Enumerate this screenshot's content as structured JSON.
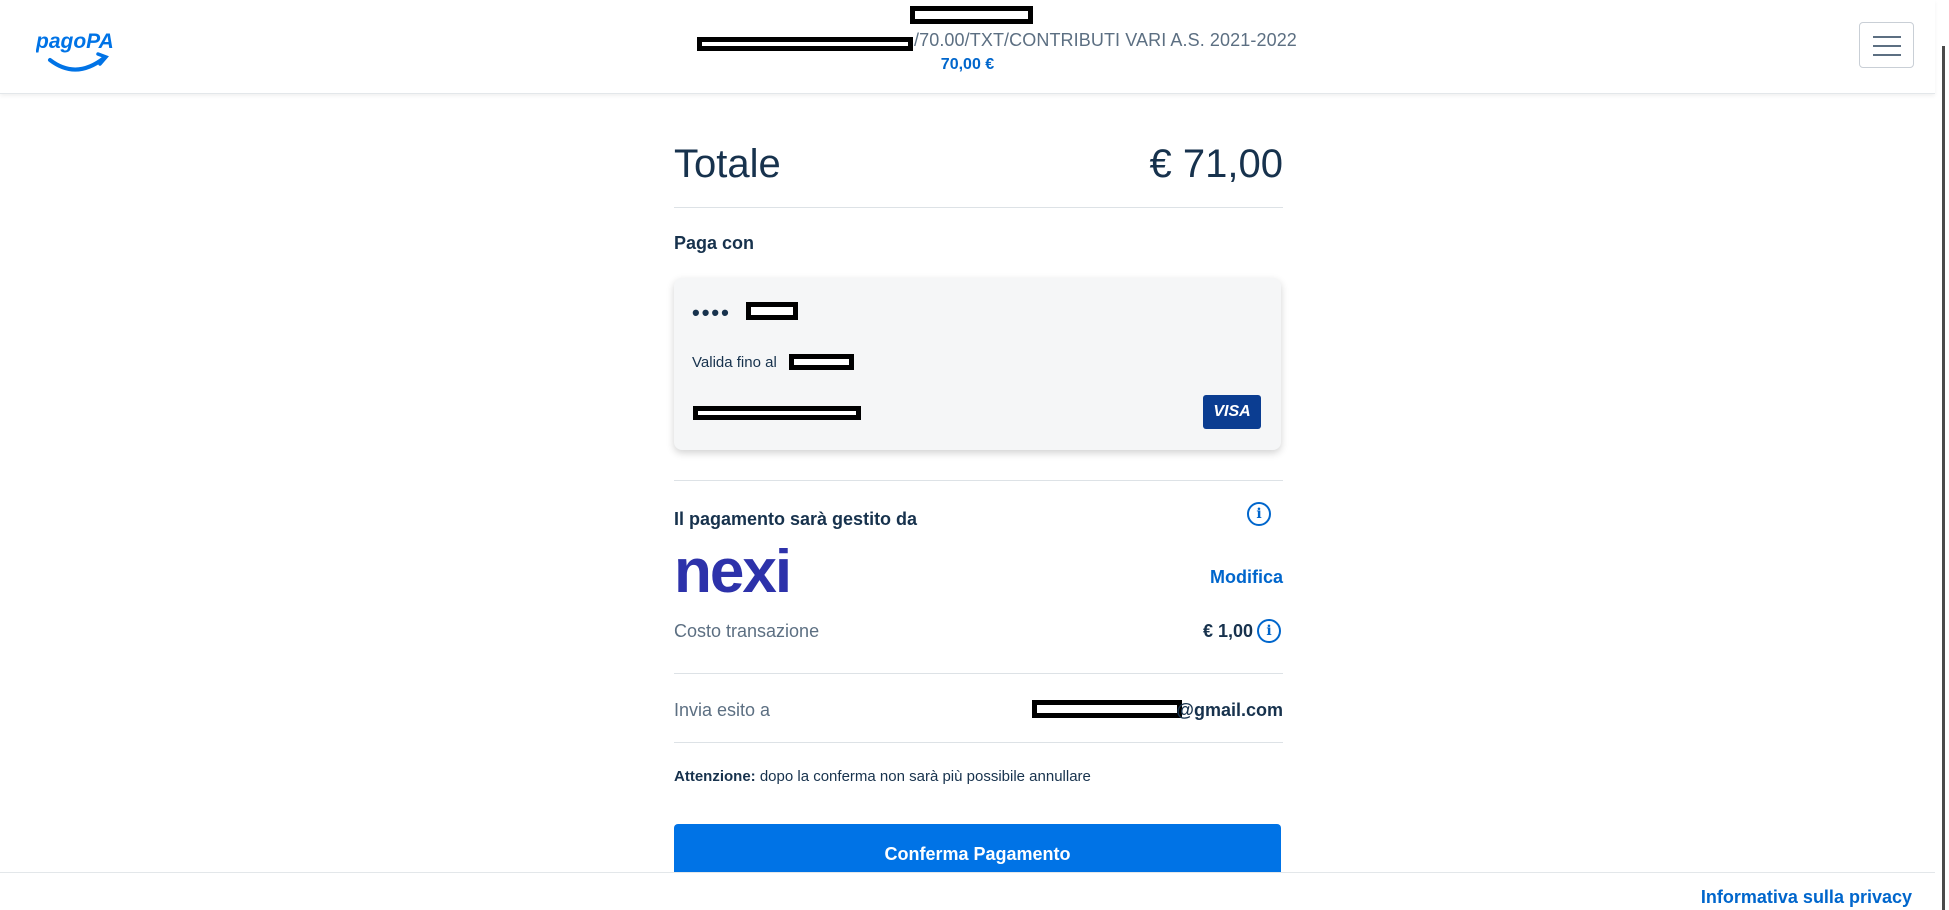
{
  "header": {
    "logo_text": "pagoPA",
    "description": "/70.00/TXT/CONTRIBUTI VARI A.S. 2021-2022",
    "amount": "70,00 €",
    "menu_icon": "hamburger-icon"
  },
  "summary": {
    "total_label": "Totale",
    "total_value": "€ 71,00"
  },
  "payment_method": {
    "section_label": "Paga con",
    "card_dots": "••••",
    "valid_label": "Valida fino al",
    "brand": "VISA"
  },
  "psp": {
    "label": "Il pagamento sarà gestito da",
    "logo_text": "nexi",
    "modify_label": "Modifica",
    "fee_label": "Costo transazione",
    "fee_value": "€ 1,00"
  },
  "email": {
    "label": "Invia esito a",
    "value": "@gmail.com"
  },
  "warning": {
    "prefix": "Attenzione:",
    "text": " dopo la conferma non sarà più possibile annullare"
  },
  "actions": {
    "confirm_label": "Conferma Pagamento"
  },
  "footer": {
    "privacy_label": "Informativa sulla privacy"
  },
  "colors": {
    "primary": "#0073e6",
    "link": "#0066cc",
    "text": "#17324d",
    "muted": "#5c6f82",
    "nexi": "#2d32aa",
    "visa": "#0b3d91"
  }
}
